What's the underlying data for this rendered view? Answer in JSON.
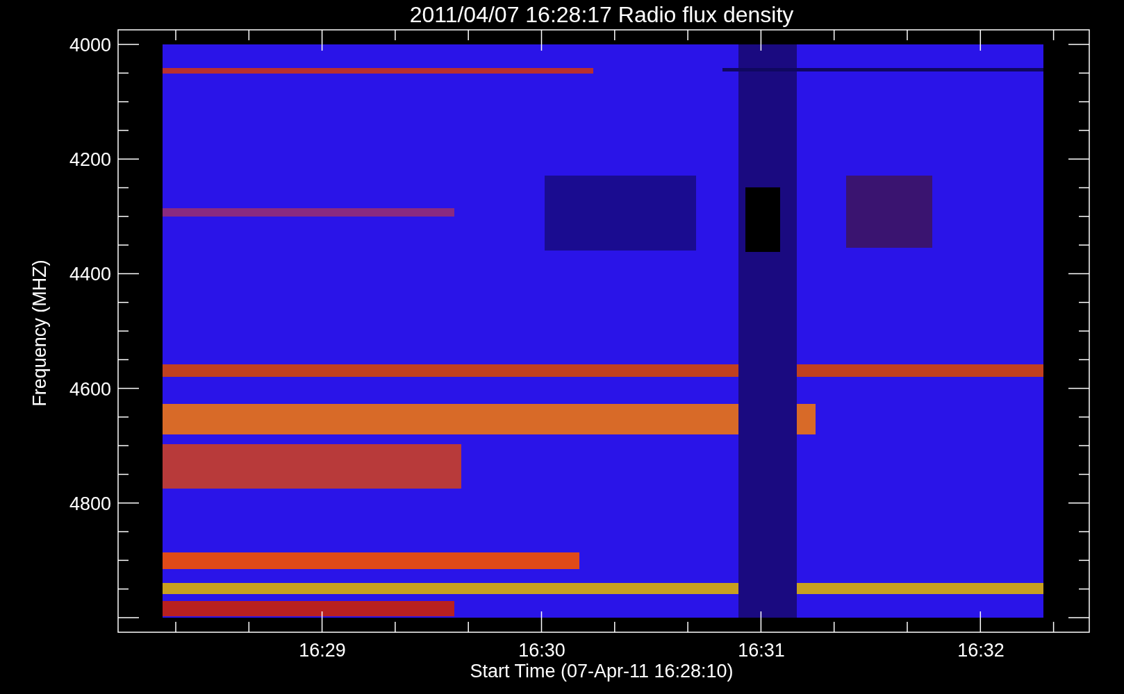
{
  "title": "2011/04/07 16:28:17 Radio flux density",
  "y_axis": {
    "label": "Frequency (MHZ)",
    "ticks": [
      "4000",
      "4200",
      "4400",
      "4600",
      "4800"
    ]
  },
  "x_axis": {
    "label": "Start Time (07-Apr-11 16:28:10)",
    "ticks": [
      "16:29",
      "16:30",
      "16:31",
      "16:32"
    ]
  }
}
